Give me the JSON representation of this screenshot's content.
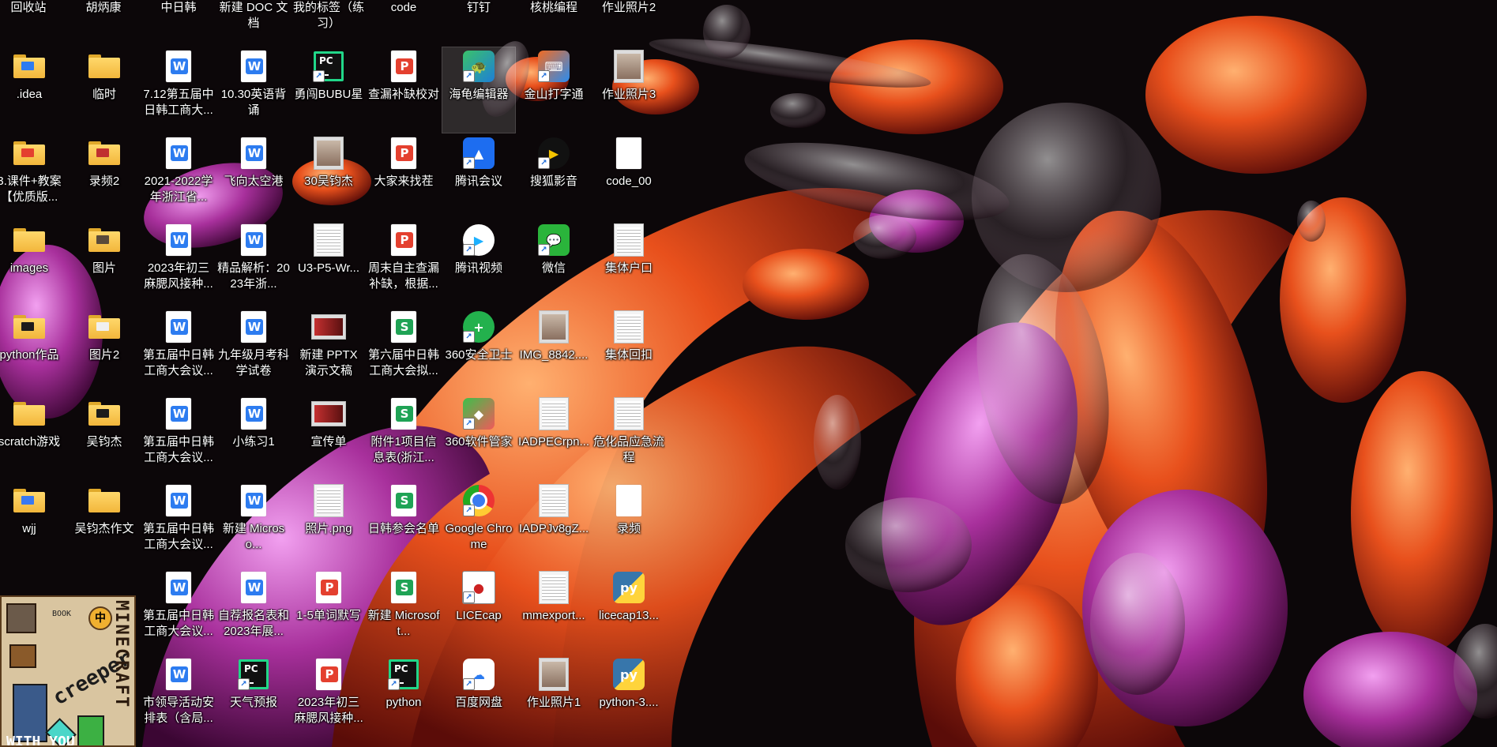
{
  "top_row": [
    "回收站",
    "胡炳康",
    "中日韩",
    "新建 DOC 文档",
    "我的标签（练习）",
    "code",
    "钉钉",
    "核桃编程",
    "作业照片2"
  ],
  "columns": [
    [
      {
        "label": ".idea",
        "icon": "folder-icon",
        "badge": "#2d7cf0"
      },
      {
        "label": "3.课件+教案【优质版...",
        "icon": "folder-icon",
        "badge": "#e4402f"
      },
      {
        "label": "images",
        "icon": "folder-icon"
      },
      {
        "label": "python作品",
        "icon": "folder-icon",
        "badge": "#1c1c1c"
      },
      {
        "label": "scratch游戏",
        "icon": "folder-icon"
      },
      {
        "label": "wjj",
        "icon": "folder-icon",
        "badge": "#3a79f0"
      }
    ],
    [
      {
        "label": "临时",
        "icon": "folder-icon"
      },
      {
        "label": "录频2",
        "icon": "folder-icon",
        "badge": "#c03030"
      },
      {
        "label": "图片",
        "icon": "folder-icon",
        "badge": "#5a4a3a"
      },
      {
        "label": "图片2",
        "icon": "folder-icon",
        "badge": "#f0f0f0"
      },
      {
        "label": "吴钧杰",
        "icon": "folder-icon",
        "badge": "#1c1c1c"
      },
      {
        "label": "吴钧杰作文",
        "icon": "folder-icon"
      }
    ],
    [
      {
        "label": "7.12第五届中日韩工商大...",
        "icon": "word-doc-icon"
      },
      {
        "label": "2021-2022学年浙江省...",
        "icon": "word-doc-icon"
      },
      {
        "label": "2023年初三麻腮风接种...",
        "icon": "word-doc-icon"
      },
      {
        "label": "第五届中日韩工商大会议...",
        "icon": "word-doc-icon"
      },
      {
        "label": "第五届中日韩工商大会议...",
        "icon": "word-doc-icon"
      },
      {
        "label": "第五届中日韩工商大会议...",
        "icon": "word-doc-icon"
      },
      {
        "label": "第五届中日韩工商大会议...",
        "icon": "word-doc-icon"
      },
      {
        "label": "市领导活动安排表（含局...",
        "icon": "word-doc-icon"
      }
    ],
    [
      {
        "label": "10.30英语背诵",
        "icon": "word-doc-icon"
      },
      {
        "label": "飞向太空港",
        "icon": "word-doc-icon"
      },
      {
        "label": "精品解析：2023年浙...",
        "icon": "word-doc-icon"
      },
      {
        "label": "九年级月考科学试卷",
        "icon": "word-doc-icon"
      },
      {
        "label": "小练习1",
        "icon": "word-doc-icon"
      },
      {
        "label": "新建 Microso...",
        "icon": "word-doc-icon"
      },
      {
        "label": "自荐报名表和2023年展...",
        "icon": "word-doc-icon"
      },
      {
        "label": "天气预报",
        "icon": "pycharm-icon"
      }
    ],
    [
      {
        "label": "勇闯BUBU星",
        "icon": "pycharm-icon"
      },
      {
        "label": "30吴钧杰",
        "icon": "photo-icon"
      },
      {
        "label": "U3-P5-Wr...",
        "icon": "image-file-icon"
      },
      {
        "label": "新建 PPTX 演示文稿",
        "icon": "slides-image-icon"
      },
      {
        "label": "宣传单",
        "icon": "slides-image-icon"
      },
      {
        "label": "照片.png",
        "icon": "image-file-icon"
      },
      {
        "label": "1-5单词默写",
        "icon": "pdf-doc-icon"
      },
      {
        "label": "2023年初三麻腮风接种...",
        "icon": "pdf-doc-icon"
      }
    ],
    [
      {
        "label": "查漏补缺校对",
        "icon": "pdf-doc-icon"
      },
      {
        "label": "大家来找茬",
        "icon": "pdf-doc-icon"
      },
      {
        "label": "周末自主查漏补缺，根据...",
        "icon": "pdf-doc-icon"
      },
      {
        "label": "第六届中日韩工商大会拟...",
        "icon": "sheet-doc-icon"
      },
      {
        "label": "附件1项目信息表(浙江...",
        "icon": "sheet-doc-icon"
      },
      {
        "label": "日韩参会名单",
        "icon": "sheet-doc-icon"
      },
      {
        "label": "新建 Microsoft...",
        "icon": "sheet-doc-icon"
      },
      {
        "label": "python",
        "icon": "pycharm-icon"
      }
    ],
    [
      {
        "label": "海龟编辑器",
        "icon": "turtle-editor-icon",
        "selected": true
      },
      {
        "label": "腾讯会议",
        "icon": "tencent-meeting-icon"
      },
      {
        "label": "腾讯视频",
        "icon": "tencent-video-icon"
      },
      {
        "label": "360安全卫士",
        "icon": "360-security-icon"
      },
      {
        "label": "360软件管家",
        "icon": "360-software-icon"
      },
      {
        "label": "Google Chrome",
        "icon": "chrome-icon"
      },
      {
        "label": "LICEcap",
        "icon": "licecap-icon"
      },
      {
        "label": "百度网盘",
        "icon": "baidu-netdisk-icon"
      }
    ],
    [
      {
        "label": "金山打字通",
        "icon": "kingsoft-typing-icon"
      },
      {
        "label": "搜狐影音",
        "icon": "sohu-video-icon"
      },
      {
        "label": "微信",
        "icon": "wechat-icon"
      },
      {
        "label": "IMG_8842....",
        "icon": "photo-icon"
      },
      {
        "label": "IADPECrpn...",
        "icon": "image-file-icon"
      },
      {
        "label": "IADPJv8gZ...",
        "icon": "image-file-icon"
      },
      {
        "label": "mmexport...",
        "icon": "image-file-icon"
      },
      {
        "label": "作业照片1",
        "icon": "photo-icon"
      }
    ],
    [
      {
        "label": "作业照片3",
        "icon": "photo-icon"
      },
      {
        "label": "code_00",
        "icon": "document-icon"
      },
      {
        "label": "集体户口",
        "icon": "image-file-icon"
      },
      {
        "label": "集体回扣",
        "icon": "image-file-icon"
      },
      {
        "label": "危化品应急流程",
        "icon": "image-file-icon"
      },
      {
        "label": "录频",
        "icon": "document-icon"
      },
      {
        "label": "licecap13...",
        "icon": "python-installer-icon"
      },
      {
        "label": "python-3....",
        "icon": "python-installer-icon"
      }
    ]
  ],
  "widget": {
    "title": "MINECRAFT",
    "tagline": "creeper",
    "book_label": "BOOK",
    "badge": "中",
    "bottom_text": "WITH YOU"
  }
}
